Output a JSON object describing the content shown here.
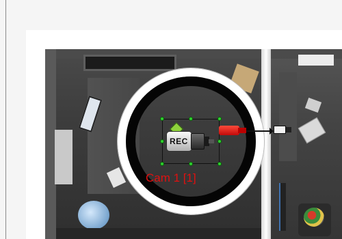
{
  "camera": {
    "rec_label": "REC",
    "caption": "Cam 1 [1]",
    "caption_color": "#e01010",
    "icon": "security-camera-icon"
  },
  "accent_colors": {
    "handle": "#2fd02f",
    "connector": "#d21010",
    "view_ring": "#000000"
  }
}
